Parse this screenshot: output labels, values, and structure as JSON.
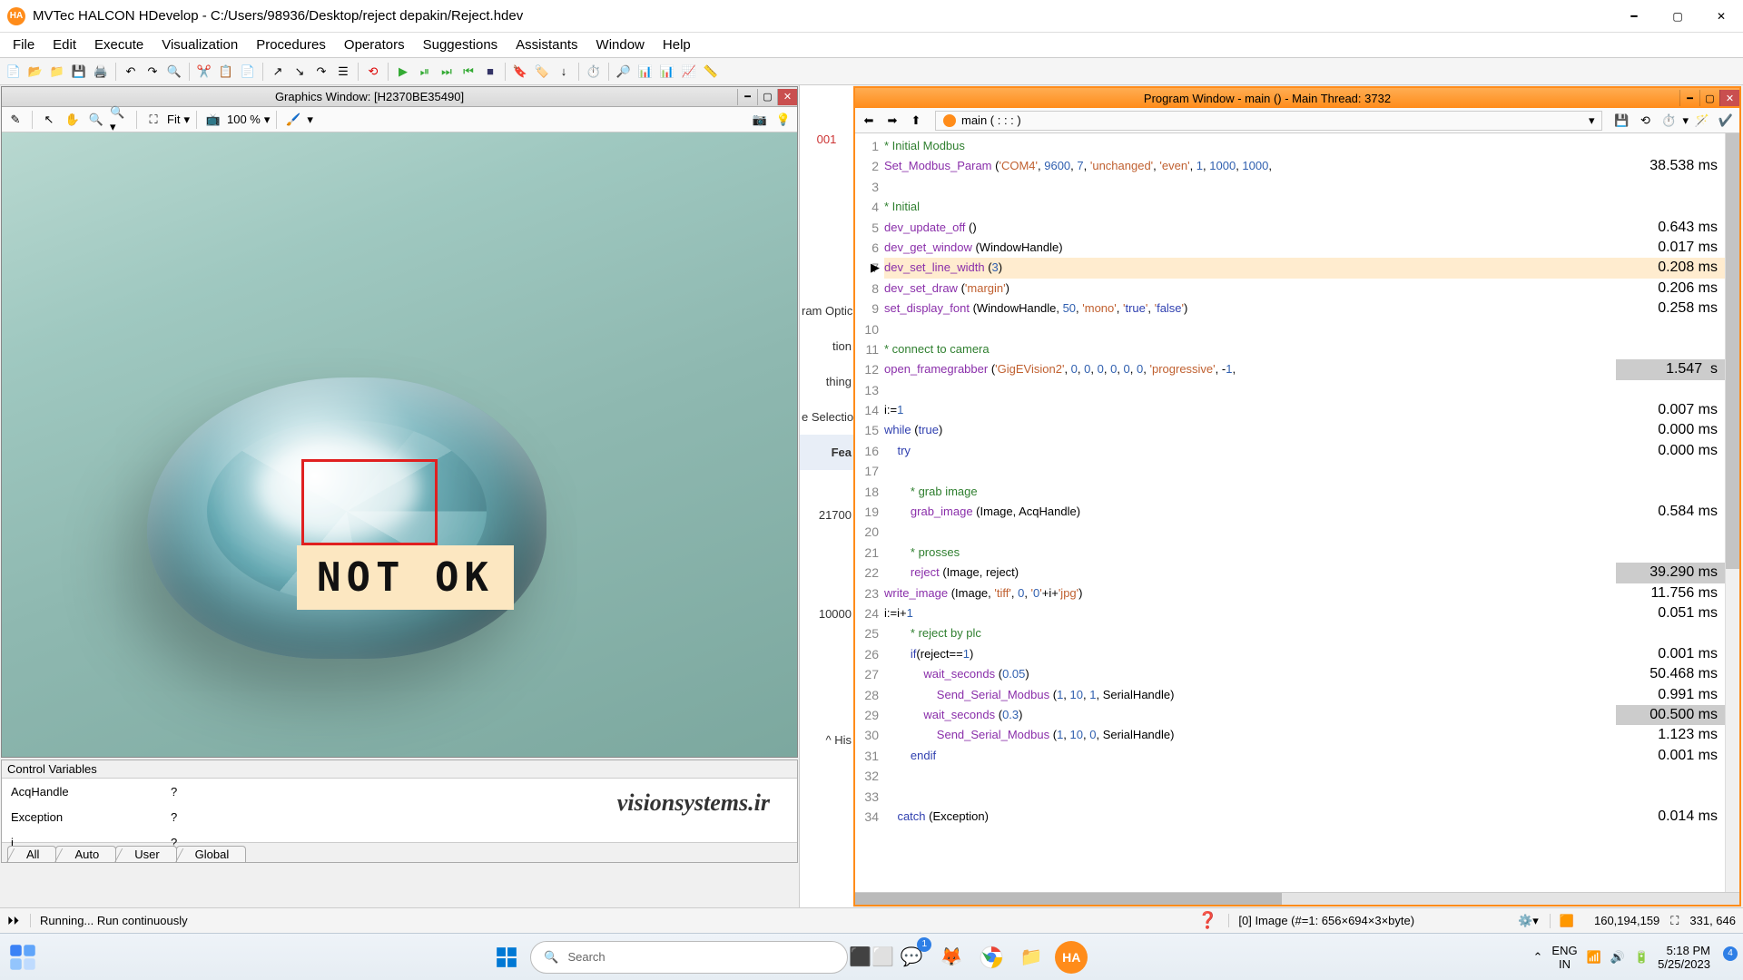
{
  "title": "MVTec HALCON HDevelop - C:/Users/98936/Desktop/reject depakin/Reject.hdev",
  "menus": [
    "File",
    "Edit",
    "Execute",
    "Visualization",
    "Procedures",
    "Operators",
    "Suggestions",
    "Assistants",
    "Window",
    "Help"
  ],
  "graphics_window": {
    "title": "Graphics Window: [H2370BE35490]",
    "fit_label": "Fit",
    "zoom_label": "100 %",
    "overlay_text": "NOT OK"
  },
  "mid_items": [
    "001",
    "ram Optic",
    "tion",
    "thing",
    "e Selectio",
    "Fea",
    "21700",
    "10000",
    "^ His"
  ],
  "program_window": {
    "title": "Program Window - main () - Main Thread: 3732",
    "breadcrumb": "main ( : : : )",
    "lines": [
      {
        "n": 1,
        "t": "* Initial Modbus",
        "cls": "cmt",
        "tm": ""
      },
      {
        "n": 2,
        "t": "Set_Modbus_Param ('COM4', 9600, 7, 'unchanged', 'even', 1, 1000, 1000, ",
        "tm": "38.538 ms"
      },
      {
        "n": 3,
        "t": "",
        "tm": ""
      },
      {
        "n": 4,
        "t": "* Initial",
        "cls": "cmt",
        "tm": ""
      },
      {
        "n": 5,
        "t": "dev_update_off ()",
        "tm": "0.643 ms"
      },
      {
        "n": 6,
        "t": "dev_get_window (WindowHandle)",
        "tm": "0.017 ms"
      },
      {
        "n": 7,
        "t": "dev_set_line_width (3)",
        "tm": "0.208 ms",
        "cur": true
      },
      {
        "n": 8,
        "t": "dev_set_draw ('margin')",
        "tm": "0.206 ms"
      },
      {
        "n": 9,
        "t": "set_display_font (WindowHandle, 50, 'mono', 'true', 'false')",
        "tm": "0.258 ms"
      },
      {
        "n": 10,
        "t": "",
        "tm": ""
      },
      {
        "n": 11,
        "t": "* connect to camera",
        "cls": "cmt",
        "tm": ""
      },
      {
        "n": 12,
        "t": "open_framegrabber ('GigEVision2', 0, 0, 0, 0, 0, 0, 'progressive', -1, ",
        "tm": "1.547  s",
        "hl": true
      },
      {
        "n": 13,
        "t": "",
        "tm": ""
      },
      {
        "n": 14,
        "t": "i:=1",
        "tm": "0.007 ms"
      },
      {
        "n": 15,
        "t": "while (true)",
        "tm": "0.000 ms"
      },
      {
        "n": 16,
        "t": "    try",
        "tm": "0.000 ms"
      },
      {
        "n": 17,
        "t": "",
        "tm": ""
      },
      {
        "n": 18,
        "t": "        * grab image",
        "cls": "cmt",
        "tm": ""
      },
      {
        "n": 19,
        "t": "        grab_image (Image, AcqHandle)",
        "tm": "0.584 ms"
      },
      {
        "n": 20,
        "t": "",
        "tm": ""
      },
      {
        "n": 21,
        "t": "        * prosses",
        "cls": "cmt",
        "tm": ""
      },
      {
        "n": 22,
        "t": "        reject (Image, reject)",
        "tm": "39.290 ms",
        "hl": true
      },
      {
        "n": 23,
        "t": "write_image (Image, 'tiff', 0, '0'+i+'jpg')",
        "tm": "11.756 ms"
      },
      {
        "n": 24,
        "t": "i:=i+1",
        "tm": "0.051 ms"
      },
      {
        "n": 25,
        "t": "        * reject by plc",
        "cls": "cmt",
        "tm": ""
      },
      {
        "n": 26,
        "t": "        if(reject==1)",
        "tm": "0.001 ms"
      },
      {
        "n": 27,
        "t": "            wait_seconds (0.05)",
        "tm": "50.468 ms"
      },
      {
        "n": 28,
        "t": "                Send_Serial_Modbus (1, 10, 1, SerialHandle)",
        "tm": "0.991 ms"
      },
      {
        "n": 29,
        "t": "            wait_seconds (0.3)",
        "tm": "00.500 ms",
        "hl": true
      },
      {
        "n": 30,
        "t": "                Send_Serial_Modbus (1, 10, 0, SerialHandle)",
        "tm": "1.123 ms"
      },
      {
        "n": 31,
        "t": "        endif",
        "tm": "0.001 ms"
      },
      {
        "n": 32,
        "t": "",
        "tm": ""
      },
      {
        "n": 33,
        "t": "",
        "tm": ""
      },
      {
        "n": 34,
        "t": "    catch (Exception)",
        "tm": "0.014 ms"
      }
    ]
  },
  "variables": {
    "header": "Control Variables",
    "rows": [
      {
        "name": "AcqHandle",
        "value": "?"
      },
      {
        "name": "Exception",
        "value": "?"
      },
      {
        "name": "i",
        "value": "?"
      }
    ],
    "tabs": [
      "All",
      "Auto",
      "User",
      "Global"
    ],
    "watermark": "visionsystems.ir"
  },
  "status": {
    "left": "Running... Run continuously",
    "middle": "[0] Image (#=1: 656×694×3×byte)",
    "mem": "160,194,159",
    "coord": "331, 646"
  },
  "taskbar": {
    "lang1": "ENG",
    "lang2": "IN",
    "time": "5:18 PM",
    "date": "5/25/2023",
    "search_ph": "Search",
    "notif": "4",
    "chat_badge": "1"
  }
}
